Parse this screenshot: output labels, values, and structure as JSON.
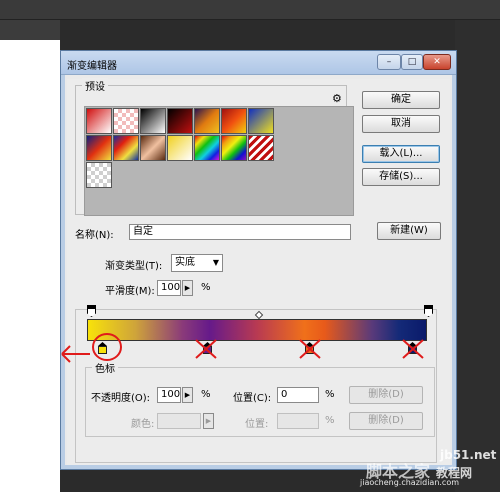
{
  "dialog": {
    "title": "渐变编辑器",
    "min_label": "–",
    "max_label": "□",
    "close_label": "✕"
  },
  "preset": {
    "legend": "预设",
    "gear": "⚙",
    "swatches": [
      "linear-gradient(135deg,#d01010,#ffffff)",
      "repeating-conic-gradient(#f2bcbc 0 25%,#ffffff 0 50%) 0 0/8px 8px",
      "linear-gradient(135deg,#000000,#ffffff)",
      "linear-gradient(135deg,#000000,#c01010)",
      "linear-gradient(135deg,#2a1450,#e07a10,#f0c020)",
      "linear-gradient(135deg,#a01010,#f05010,#f0d010)",
      "linear-gradient(135deg,#1030c0,#f0e020)",
      "linear-gradient(135deg,#102080,#e03010,#f0e040)",
      "linear-gradient(135deg,#1830a0,#e02010,#f0e040,#1030a0)",
      "linear-gradient(135deg,#5a2a10,#f0c0a0,#5a2a10)",
      "linear-gradient(135deg,#f0d020,#ffffff)",
      "linear-gradient(135deg,#e01010,#f0e010,#10c010,#10d0e0,#1020e0,#e010e0)",
      "linear-gradient(135deg,#e01010,#f0a010,#f0f010,#10c010,#1010d0,#9010c0)",
      "repeating-linear-gradient(135deg,#c01010 0 3px,#ffffff 3px 6px)",
      "repeating-conic-gradient(#cfcfcf 0 25%,#ffffff 0 50%) 0 0/8px 8px"
    ]
  },
  "buttons": {
    "ok": "确定",
    "cancel": "取消",
    "load": "载入(L)...",
    "save": "存储(S)...",
    "new": "新建(W)",
    "delete1": "删除(D)",
    "delete2": "删除(D)"
  },
  "name": {
    "label": "名称(N):",
    "value": "自定"
  },
  "gradient": {
    "type_label": "渐变类型(T):",
    "type_value": "实底",
    "smooth_label": "平滑度(M):",
    "smooth_value": "100",
    "smooth_unit": "%",
    "bar": "linear-gradient(to right,#f8e20a 0%,#cfa43a 14%,#8a3a7a 28%,#661a8a 36%,#b83a52 50%,#f0701a 64%,#e85a1a 70%,#5a3a7a 84%,#142a78 92%,#0a1a6a 100%)",
    "stop_colors": [
      "#f8e20a",
      "#6a1a8a",
      "#f06a1a",
      "#0a1a6a"
    ]
  },
  "color_stops": {
    "legend": "色标",
    "opacity_label": "不透明度(O):",
    "opacity_value": "100",
    "opacity_unit": "%",
    "position_label": "位置(C):",
    "position_value": "0",
    "position_unit": "%",
    "color_label": "颜色:",
    "position2_label": "位置:",
    "position2_unit": "%"
  },
  "watermark": {
    "site": "jb51.net",
    "text": "脚本之家",
    "tutorial": "教程网",
    "url": "jiaocheng.chazidian.com"
  },
  "colors": {
    "annotation": "#e01b1b",
    "title_bar": "#aec6e6"
  }
}
